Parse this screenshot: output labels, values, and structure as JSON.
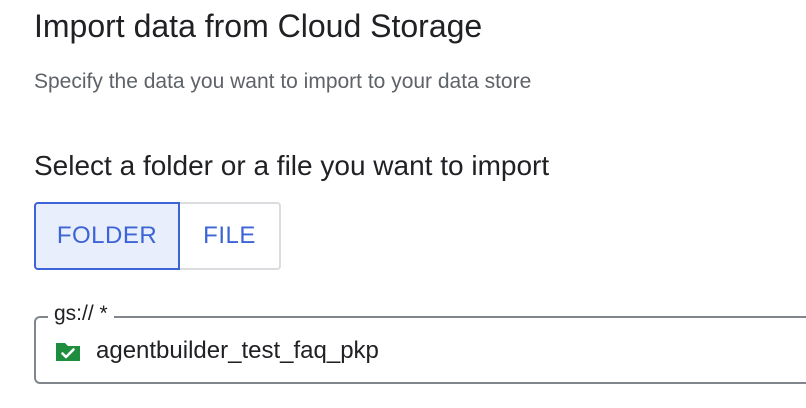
{
  "header": {
    "title": "Import data from Cloud Storage",
    "subtitle": "Specify the data you want to import to your data store"
  },
  "selection": {
    "heading": "Select a folder or a file you want to import",
    "toggle": [
      {
        "label": "FOLDER",
        "selected": true
      },
      {
        "label": "FILE",
        "selected": false
      }
    ]
  },
  "gcs_field": {
    "label": "gs:// *",
    "value": "agentbuilder_test_faq_pkp",
    "icon": "bucket-check-icon"
  },
  "colors": {
    "accent": "#3c64d6",
    "selected_bg": "#e8eefb",
    "icon_green": "#1e8e3e"
  }
}
